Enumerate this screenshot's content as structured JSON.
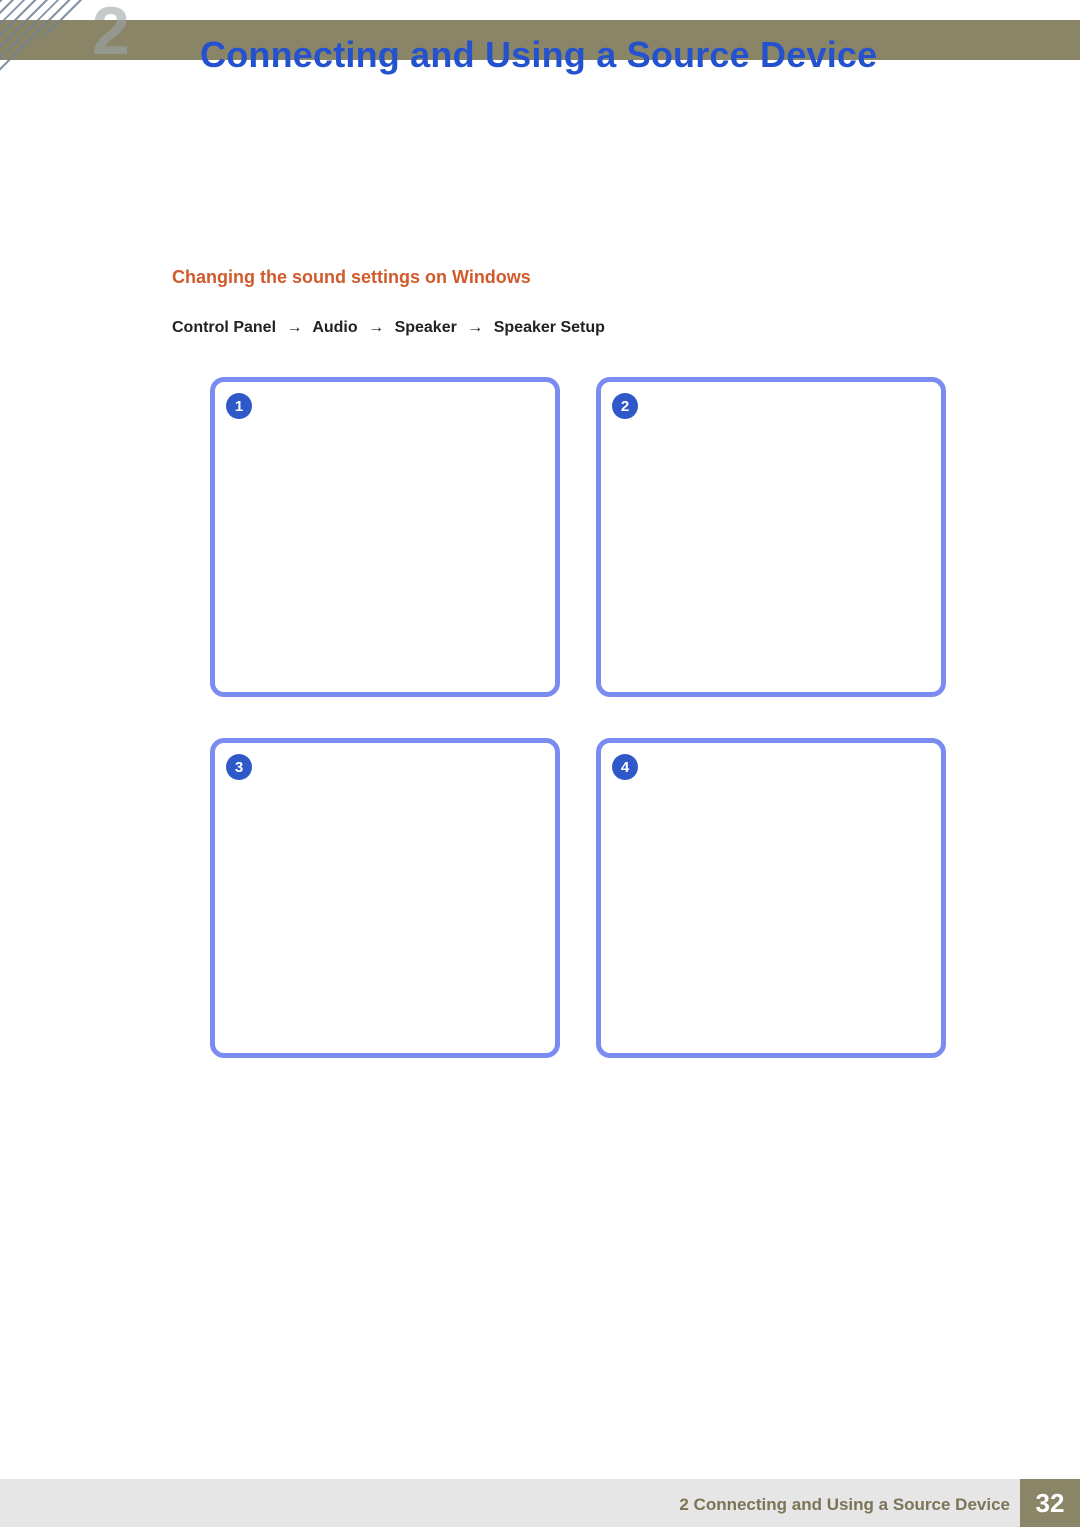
{
  "header": {
    "chapter_number": "2",
    "chapter_title": "Connecting and Using a Source Device"
  },
  "section": {
    "title": "Changing the sound settings on Windows",
    "breadcrumb": [
      "Control Panel",
      "Audio",
      "Speaker",
      "Speaker Setup"
    ]
  },
  "steps": [
    {
      "number": "1"
    },
    {
      "number": "2"
    },
    {
      "number": "3"
    },
    {
      "number": "4"
    }
  ],
  "footer": {
    "text": "2 Connecting and Using a Source Device",
    "page": "32"
  }
}
